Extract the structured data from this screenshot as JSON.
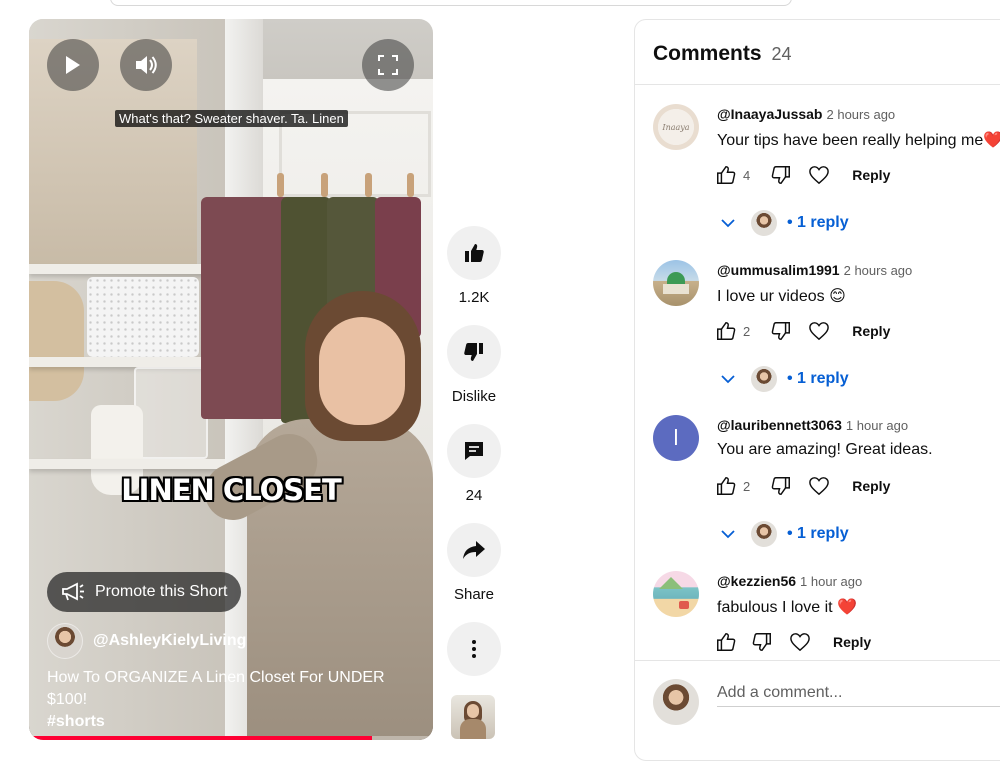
{
  "video": {
    "caption": "What's that? Sweater shaver. Ta. Linen",
    "overlay_title": "LINEN CLOSET",
    "promote_label": "Promote this Short",
    "channel": "@AshleyKielyLiving",
    "title": "How To ORGANIZE A Linen Closet For UNDER $100!",
    "hashtag": "#shorts",
    "progress": 0.85
  },
  "actions": {
    "like_count": "1.2K",
    "dislike_label": "Dislike",
    "comment_count": "24",
    "share_label": "Share"
  },
  "comments": {
    "title": "Comments",
    "count": "24",
    "items": [
      {
        "author": "@InaayaJussab",
        "time": "2 hours ago",
        "text": "Your tips have been really helping me",
        "emoji": "❤️",
        "likes": "4",
        "avatar_text": "Inaaya",
        "replies": "1 reply"
      },
      {
        "author": "@ummusalim1991",
        "time": "2 hours ago",
        "text": "I love ur videos",
        "emoji": "😊",
        "likes": "2",
        "replies": "1 reply"
      },
      {
        "author": "@lauribennett3063",
        "time": "1 hour ago",
        "text": "You are amazing! Great ideas.",
        "likes": "2",
        "avatar_letter": "l",
        "replies": "1 reply"
      },
      {
        "author": "@kezzien56",
        "time": "1 hour ago",
        "text": "fabulous I love it",
        "emoji": "❤️",
        "likes": ""
      }
    ],
    "reply_label": "Reply",
    "add_placeholder": "Add a comment..."
  },
  "colors": {
    "accent_blue": "#065fd4",
    "progress_red": "#ff0033",
    "avatar_purple": "#5c6bc0"
  }
}
